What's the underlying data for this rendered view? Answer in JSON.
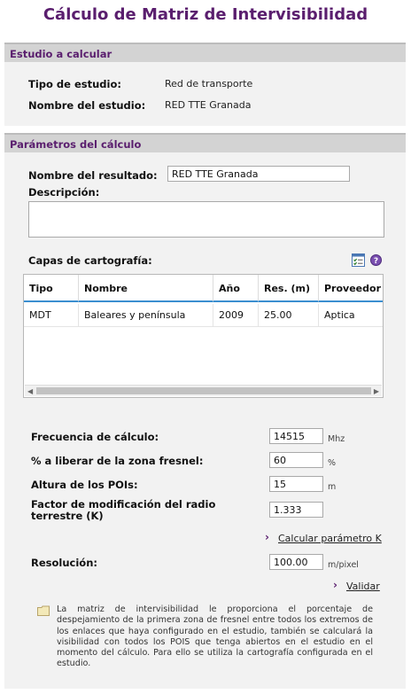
{
  "title": "Cálculo de Matriz de Intervisibilidad",
  "study": {
    "header": "Estudio a calcular",
    "type_label": "Tipo de estudio:",
    "type_value": "Red de transporte",
    "name_label": "Nombre del estudio:",
    "name_value": "RED TTE Granada"
  },
  "params": {
    "header": "Parámetros del cálculo",
    "result_label": "Nombre del resultado:",
    "result_value": "RED TTE Granada",
    "description_label": "Descripción:",
    "description_value": "",
    "layers_label": "Capas de cartografía:",
    "layers_table": {
      "columns": [
        "Tipo",
        "Nombre",
        "Año",
        "Res. (m)",
        "Proveedor"
      ],
      "rows": [
        [
          "MDT",
          "Baleares y península",
          "2009",
          "25.00",
          "Aptica"
        ]
      ]
    },
    "frequency_label": "Frecuencia de cálculo:",
    "frequency_value": "14515",
    "frequency_unit": "Mhz",
    "fresnel_label": "% a liberar de la zona fresnel:",
    "fresnel_value": "60",
    "fresnel_unit": "%",
    "poi_height_label": "Altura de los POIs:",
    "poi_height_value": "15",
    "poi_height_unit": "m",
    "k_factor_label": "Factor de modificación del radio terrestre (K)",
    "k_factor_value": "1.333",
    "calc_k_link": "Calcular parámetro K",
    "resolution_label": "Resolución:",
    "resolution_value": "100.00",
    "resolution_unit": "m/pixel",
    "validate_link": "Validar",
    "info_text": "La matriz de intervisibilidad le proporciona el porcentaje de despejamiento de la primera zona de fresnel entre todos los extremos de los enlaces que haya configurado en el estudio, también se calculará la visibilidad con todos los POIS que tenga abiertos en el estudio en el momento del cálculo. Para ello se utiliza la cartografía configurada en el estudio."
  },
  "icons": {
    "layers_list": "checklist-icon",
    "help": "help-icon",
    "chevron": "chevron-right-icon",
    "info": "note-icon"
  },
  "colors": {
    "accent": "#5a1e6e",
    "header_bg": "#d3d3d3",
    "panel_bg": "#f2f2f2",
    "grid_header_line": "#3b8fd0"
  }
}
